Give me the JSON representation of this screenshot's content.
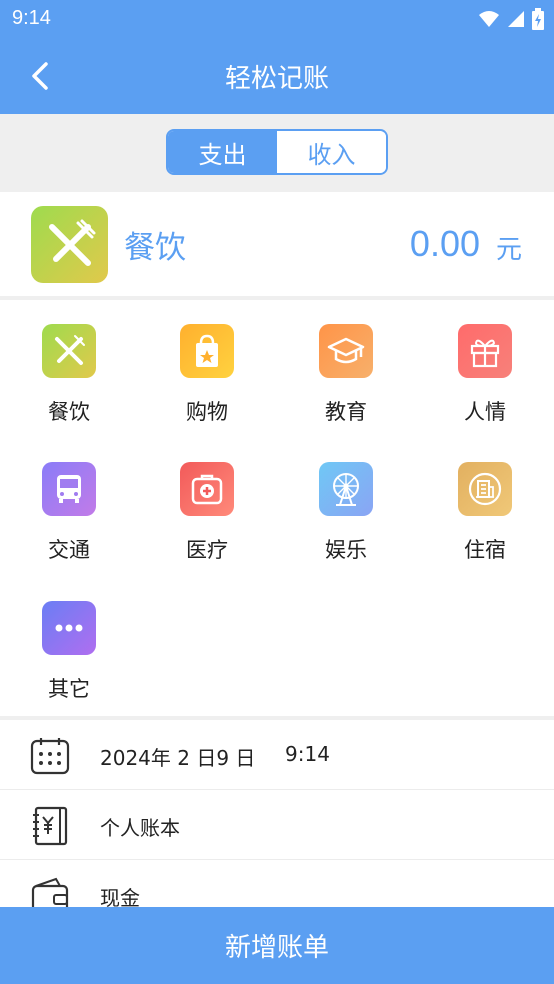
{
  "status_bar": {
    "time": "9:14",
    "icons": [
      "wifi-icon",
      "signal-icon",
      "battery-icon"
    ]
  },
  "header": {
    "title": "轻松记账",
    "back_icon": "chevron-left-icon"
  },
  "tabs": [
    {
      "label": "支出",
      "active": true
    },
    {
      "label": "收入",
      "active": false
    }
  ],
  "selected": {
    "name": "餐饮",
    "amount": "0.00",
    "unit": "元",
    "icon": "fork-knife-icon"
  },
  "categories": [
    {
      "label": "餐饮",
      "icon": "fork-knife-icon",
      "color_from": "#9edb4e",
      "color_to": "#e1c94b"
    },
    {
      "label": "购物",
      "icon": "shopping-bag-icon",
      "color_from": "#ffb02e",
      "color_to": "#ffd23f"
    },
    {
      "label": "教育",
      "icon": "graduation-cap-icon",
      "color_from": "#ff9448",
      "color_to": "#f7b06b"
    },
    {
      "label": "人情",
      "icon": "gift-icon",
      "color_from": "#ff6b6b",
      "color_to": "#f7817a"
    },
    {
      "label": "交通",
      "icon": "bus-icon",
      "color_from": "#8a7cf8",
      "color_to": "#c27be8"
    },
    {
      "label": "医疗",
      "icon": "medical-kit-icon",
      "color_from": "#f25a5a",
      "color_to": "#ff8a7a"
    },
    {
      "label": "娱乐",
      "icon": "ferris-wheel-icon",
      "color_from": "#6fc8f5",
      "color_to": "#8aa4f4"
    },
    {
      "label": "住宿",
      "icon": "hotel-icon",
      "color_from": "#e2b060",
      "color_to": "#f0c878"
    },
    {
      "label": "其它",
      "icon": "more-dots-icon",
      "color_from": "#6a7ef4",
      "color_to": "#b06ef0"
    }
  ],
  "info": {
    "date": "2024年 2 日9 日",
    "time": "9:14",
    "book": "个人账本",
    "account": "现金"
  },
  "add_button": {
    "label": "新增账单"
  },
  "colors": {
    "primary": "#5b9ff2",
    "background_gray": "#efefef"
  }
}
